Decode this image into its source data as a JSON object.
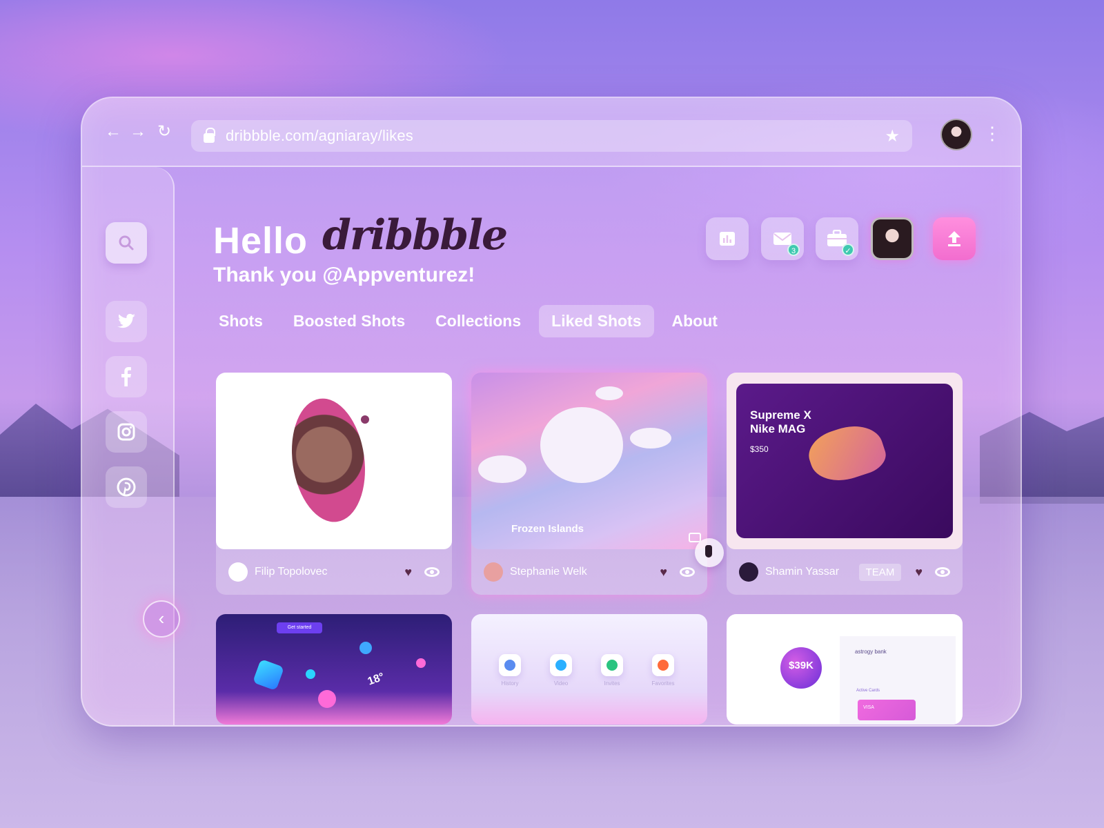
{
  "browser": {
    "url": "dribbble.com/agniaray/likes",
    "back_icon": "←",
    "forward_icon": "→",
    "reload_icon": "↻",
    "star_icon": "★",
    "menu_icon": "⋮"
  },
  "header": {
    "hello": "Hello",
    "logo_text": "dribbble",
    "thanks": "Thank you @Appventurez!",
    "mail_badge": "3"
  },
  "tabs": [
    {
      "label": "Shots",
      "active": false
    },
    {
      "label": "Boosted Shots",
      "active": false
    },
    {
      "label": "Collections",
      "active": false
    },
    {
      "label": "Liked Shots",
      "active": true
    },
    {
      "label": "About",
      "active": false
    }
  ],
  "sidebar": {
    "icons": [
      "search-icon",
      "twitter-icon",
      "facebook-icon",
      "instagram-icon",
      "pinterest-icon"
    ],
    "collapse_icon": "‹"
  },
  "shots": [
    {
      "author": "Filip Topolovec",
      "title": "",
      "team": ""
    },
    {
      "author": "Stephanie Welk",
      "title": "Frozen Islands",
      "team": ""
    },
    {
      "author": "Shamin Yassar",
      "title": "Supreme X Nike MAG",
      "price": "$350",
      "team": "TEAM"
    }
  ],
  "shots_row2": {
    "get_started": "Get started",
    "temperature": "18°",
    "icons": [
      "History",
      "Video",
      "Invites",
      "Favorites"
    ],
    "amount": "$39K",
    "bank": "astrogy bank",
    "active_cards": "Active Cards",
    "visa": "VISA"
  },
  "colors": {
    "accent_pink": "#f26dcf",
    "badge_teal": "#3fc9b0",
    "logo_dark": "#3a1a3a"
  }
}
